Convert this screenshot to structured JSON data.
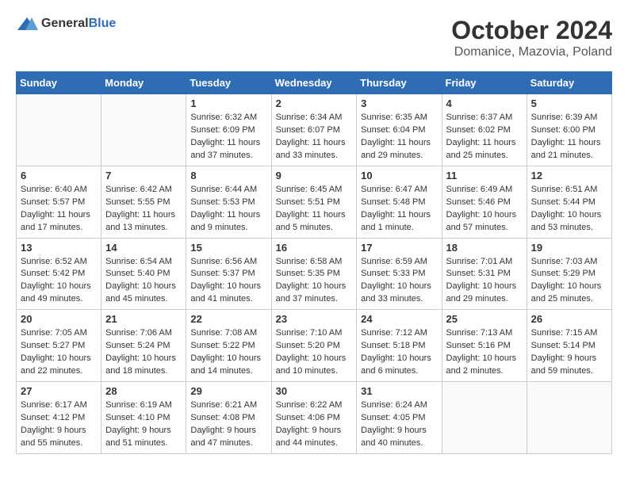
{
  "header": {
    "logo_general": "General",
    "logo_blue": "Blue",
    "month_title": "October 2024",
    "location": "Domanice, Mazovia, Poland"
  },
  "weekdays": [
    "Sunday",
    "Monday",
    "Tuesday",
    "Wednesday",
    "Thursday",
    "Friday",
    "Saturday"
  ],
  "weeks": [
    [
      {
        "day": "",
        "info": ""
      },
      {
        "day": "",
        "info": ""
      },
      {
        "day": "1",
        "info": "Sunrise: 6:32 AM\nSunset: 6:09 PM\nDaylight: 11 hours and 37 minutes."
      },
      {
        "day": "2",
        "info": "Sunrise: 6:34 AM\nSunset: 6:07 PM\nDaylight: 11 hours and 33 minutes."
      },
      {
        "day": "3",
        "info": "Sunrise: 6:35 AM\nSunset: 6:04 PM\nDaylight: 11 hours and 29 minutes."
      },
      {
        "day": "4",
        "info": "Sunrise: 6:37 AM\nSunset: 6:02 PM\nDaylight: 11 hours and 25 minutes."
      },
      {
        "day": "5",
        "info": "Sunrise: 6:39 AM\nSunset: 6:00 PM\nDaylight: 11 hours and 21 minutes."
      }
    ],
    [
      {
        "day": "6",
        "info": "Sunrise: 6:40 AM\nSunset: 5:57 PM\nDaylight: 11 hours and 17 minutes."
      },
      {
        "day": "7",
        "info": "Sunrise: 6:42 AM\nSunset: 5:55 PM\nDaylight: 11 hours and 13 minutes."
      },
      {
        "day": "8",
        "info": "Sunrise: 6:44 AM\nSunset: 5:53 PM\nDaylight: 11 hours and 9 minutes."
      },
      {
        "day": "9",
        "info": "Sunrise: 6:45 AM\nSunset: 5:51 PM\nDaylight: 11 hours and 5 minutes."
      },
      {
        "day": "10",
        "info": "Sunrise: 6:47 AM\nSunset: 5:48 PM\nDaylight: 11 hours and 1 minute."
      },
      {
        "day": "11",
        "info": "Sunrise: 6:49 AM\nSunset: 5:46 PM\nDaylight: 10 hours and 57 minutes."
      },
      {
        "day": "12",
        "info": "Sunrise: 6:51 AM\nSunset: 5:44 PM\nDaylight: 10 hours and 53 minutes."
      }
    ],
    [
      {
        "day": "13",
        "info": "Sunrise: 6:52 AM\nSunset: 5:42 PM\nDaylight: 10 hours and 49 minutes."
      },
      {
        "day": "14",
        "info": "Sunrise: 6:54 AM\nSunset: 5:40 PM\nDaylight: 10 hours and 45 minutes."
      },
      {
        "day": "15",
        "info": "Sunrise: 6:56 AM\nSunset: 5:37 PM\nDaylight: 10 hours and 41 minutes."
      },
      {
        "day": "16",
        "info": "Sunrise: 6:58 AM\nSunset: 5:35 PM\nDaylight: 10 hours and 37 minutes."
      },
      {
        "day": "17",
        "info": "Sunrise: 6:59 AM\nSunset: 5:33 PM\nDaylight: 10 hours and 33 minutes."
      },
      {
        "day": "18",
        "info": "Sunrise: 7:01 AM\nSunset: 5:31 PM\nDaylight: 10 hours and 29 minutes."
      },
      {
        "day": "19",
        "info": "Sunrise: 7:03 AM\nSunset: 5:29 PM\nDaylight: 10 hours and 25 minutes."
      }
    ],
    [
      {
        "day": "20",
        "info": "Sunrise: 7:05 AM\nSunset: 5:27 PM\nDaylight: 10 hours and 22 minutes."
      },
      {
        "day": "21",
        "info": "Sunrise: 7:06 AM\nSunset: 5:24 PM\nDaylight: 10 hours and 18 minutes."
      },
      {
        "day": "22",
        "info": "Sunrise: 7:08 AM\nSunset: 5:22 PM\nDaylight: 10 hours and 14 minutes."
      },
      {
        "day": "23",
        "info": "Sunrise: 7:10 AM\nSunset: 5:20 PM\nDaylight: 10 hours and 10 minutes."
      },
      {
        "day": "24",
        "info": "Sunrise: 7:12 AM\nSunset: 5:18 PM\nDaylight: 10 hours and 6 minutes."
      },
      {
        "day": "25",
        "info": "Sunrise: 7:13 AM\nSunset: 5:16 PM\nDaylight: 10 hours and 2 minutes."
      },
      {
        "day": "26",
        "info": "Sunrise: 7:15 AM\nSunset: 5:14 PM\nDaylight: 9 hours and 59 minutes."
      }
    ],
    [
      {
        "day": "27",
        "info": "Sunrise: 6:17 AM\nSunset: 4:12 PM\nDaylight: 9 hours and 55 minutes."
      },
      {
        "day": "28",
        "info": "Sunrise: 6:19 AM\nSunset: 4:10 PM\nDaylight: 9 hours and 51 minutes."
      },
      {
        "day": "29",
        "info": "Sunrise: 6:21 AM\nSunset: 4:08 PM\nDaylight: 9 hours and 47 minutes."
      },
      {
        "day": "30",
        "info": "Sunrise: 6:22 AM\nSunset: 4:06 PM\nDaylight: 9 hours and 44 minutes."
      },
      {
        "day": "31",
        "info": "Sunrise: 6:24 AM\nSunset: 4:05 PM\nDaylight: 9 hours and 40 minutes."
      },
      {
        "day": "",
        "info": ""
      },
      {
        "day": "",
        "info": ""
      }
    ]
  ]
}
